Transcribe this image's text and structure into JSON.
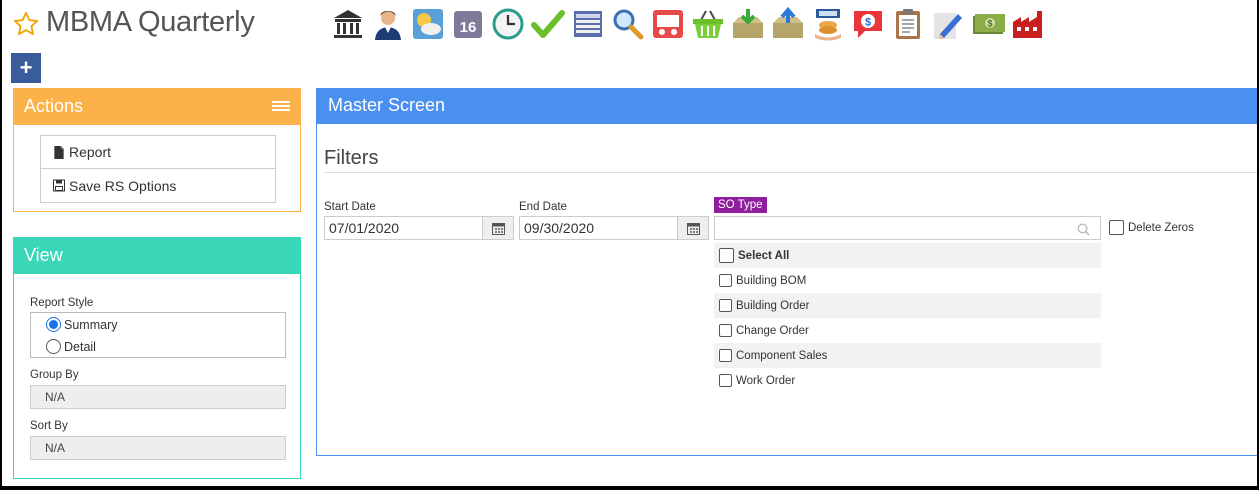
{
  "header": {
    "title": "MBMA Quarterly",
    "favorite_icon": "star-outline-icon",
    "toolbar_icons": [
      "bank-icon",
      "user-icon",
      "weather-icon",
      "calendar-16-icon",
      "clock-icon",
      "checkmark-icon",
      "spreadsheet-icon",
      "magnifier-icon",
      "truck-icon",
      "basket-icon",
      "inbox-download-icon",
      "inbox-upload-icon",
      "hand-coins-icon",
      "chat-dollar-icon",
      "clipboard-icon",
      "pencil-icon",
      "money-icon",
      "factory-icon"
    ],
    "add_button_label": "+"
  },
  "actions": {
    "title": "Actions",
    "items": [
      {
        "label": "Report",
        "icon": "document-icon"
      },
      {
        "label": "Save RS Options",
        "icon": "floppy-disk-icon"
      }
    ]
  },
  "view": {
    "title": "View",
    "report_style_label": "Report Style",
    "report_style_options": [
      {
        "label": "Summary",
        "selected": true
      },
      {
        "label": "Detail",
        "selected": false
      }
    ],
    "group_by_label": "Group By",
    "group_by_value": "N/A",
    "sort_by_label": "Sort By",
    "sort_by_value": "N/A"
  },
  "master": {
    "title": "Master Screen",
    "filters_title": "Filters",
    "start_date_label": "Start Date",
    "start_date_value": "07/01/2020",
    "end_date_label": "End Date",
    "end_date_value": "09/30/2020",
    "so_type_label": "SO Type",
    "so_type_search_value": "",
    "so_type_options": [
      {
        "label": "Select All",
        "checked": false
      },
      {
        "label": "Building BOM",
        "checked": false
      },
      {
        "label": "Building Order",
        "checked": false
      },
      {
        "label": "Change Order",
        "checked": false
      },
      {
        "label": "Component Sales",
        "checked": false
      },
      {
        "label": "Work Order",
        "checked": false
      }
    ],
    "delete_zeros_label": "Delete Zeros",
    "delete_zeros_checked": false
  },
  "colors": {
    "actions_accent": "#fbb24a",
    "view_accent": "#3ad6b8",
    "master_accent": "#4a90f0",
    "so_type_badge": "#8e1e9e",
    "add_button": "#3b5c9a"
  }
}
